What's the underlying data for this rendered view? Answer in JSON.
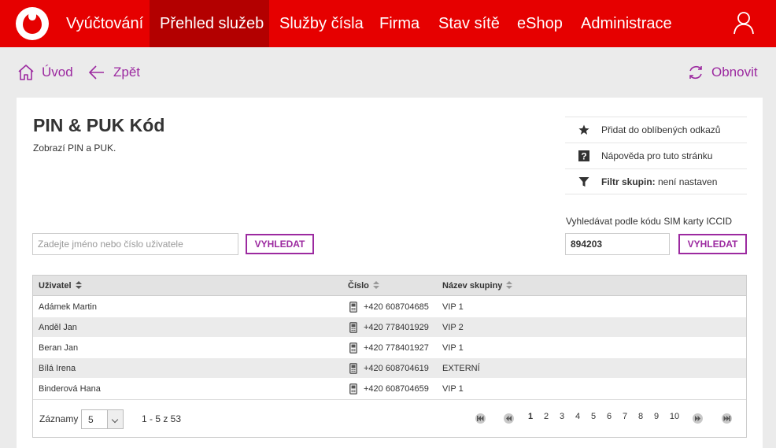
{
  "nav": {
    "items": [
      "Vyúčtování",
      "Přehled služeb",
      "Služby čísla",
      "Firma",
      "Stav sítě",
      "eShop",
      "Administrace"
    ],
    "active_index": 1
  },
  "actions": {
    "home": "Úvod",
    "back": "Zpět",
    "refresh": "Obnovit"
  },
  "page": {
    "title": "PIN & PUK Kód",
    "subtitle": "Zobrazí PIN a PUK."
  },
  "quick_links": {
    "favorite": "Přidat do oblíbených odkazů",
    "help": "Nápověda pro tuto stránku",
    "filter_label": "Filtr skupin:",
    "filter_value": " není nastaven"
  },
  "search": {
    "placeholder": "Zadejte jméno nebo číslo uživatele",
    "button": "VYHLEDAT"
  },
  "iccid": {
    "label": "Vyhledávat podle kódu SIM karty ICCID",
    "value": "894203",
    "button": "VYHLEDAT"
  },
  "table": {
    "headers": {
      "user": "Uživatel",
      "number": "Číslo",
      "group": "Název skupiny"
    },
    "rows": [
      {
        "user": "Adámek Martin",
        "number": "+420 608704685",
        "group": "VIP 1"
      },
      {
        "user": "Anděl Jan",
        "number": "+420 778401929",
        "group": "VIP 2"
      },
      {
        "user": "Beran Jan",
        "number": "+420 778401927",
        "group": "VIP 1"
      },
      {
        "user": "Bílá Irena",
        "number": "+420 608704619",
        "group": "EXTERNÍ"
      },
      {
        "user": "Binderová Hana",
        "number": "+420 608704659",
        "group": "VIP 1"
      }
    ]
  },
  "footer": {
    "records_label": "Záznamy",
    "records_value": "5",
    "range": "1 - 5 z 53",
    "pages": [
      "1",
      "2",
      "3",
      "4",
      "5",
      "6",
      "7",
      "8",
      "9",
      "10"
    ],
    "current_page": "1"
  },
  "colors": {
    "brand_red": "#e60000",
    "active_red": "#b30000",
    "accent_purple": "#9c2aa0"
  }
}
